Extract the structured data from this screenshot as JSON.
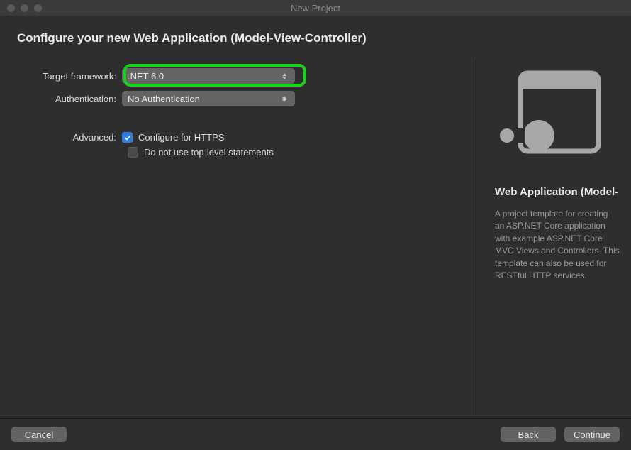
{
  "window": {
    "title": "New Project"
  },
  "heading": "Configure your new Web Application (Model-View-Controller)",
  "form": {
    "target_framework_label": "Target framework:",
    "target_framework_value": ".NET 6.0",
    "authentication_label": "Authentication:",
    "authentication_value": "No Authentication",
    "advanced_label": "Advanced:",
    "https_label": "Configure for HTTPS",
    "https_checked": true,
    "toplevel_label": "Do not use top-level statements",
    "toplevel_checked": false
  },
  "side": {
    "title": "Web Application (Model-",
    "description": "A project template for creating an ASP.NET Core application with example ASP.NET Core MVC Views and Controllers. This template can also be used for RESTful HTTP services."
  },
  "footer": {
    "cancel": "Cancel",
    "back": "Back",
    "continue": "Continue"
  },
  "highlight": {
    "target": "target-framework-select"
  }
}
